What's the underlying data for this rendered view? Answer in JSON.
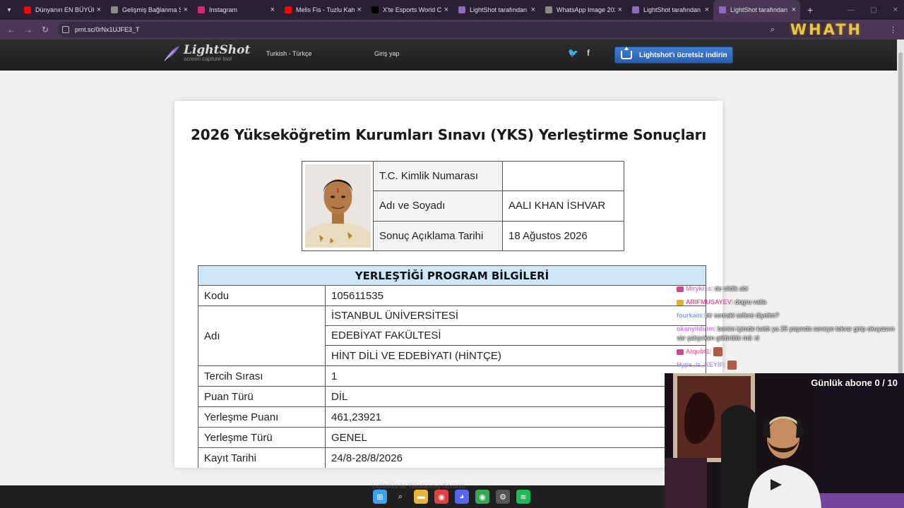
{
  "browser": {
    "tabs": [
      {
        "title": "Dünyanın EN BÜYÜK",
        "icon": "youtube-icon",
        "color": "#ff0000"
      },
      {
        "title": "Gelişmiş Bağlanma Sı",
        "icon": "globe-icon",
        "color": "#8a8a8a"
      },
      {
        "title": "Instagram",
        "icon": "instagram-icon",
        "color": "#d62976"
      },
      {
        "title": "Melis Fis - Tuzlu Kahv",
        "icon": "youtube-icon",
        "color": "#ff0000"
      },
      {
        "title": "X'te Esports World C",
        "icon": "x-icon",
        "color": "#000000"
      },
      {
        "title": "LightShot tarafından",
        "icon": "lightshot-icon",
        "color": "#8e6bbf"
      },
      {
        "title": "WhatsApp Image 202",
        "icon": "globe-icon",
        "color": "#8a8a8a"
      },
      {
        "title": "LightShot tarafından",
        "icon": "lightshot-icon",
        "color": "#8e6bbf"
      },
      {
        "title": "LightShot tarafından",
        "icon": "lightshot-icon",
        "color": "#8e6bbf",
        "active": true
      }
    ],
    "url": "prnt.sc/0rNx1UJFE3_T"
  },
  "stream_logo": "WHATH",
  "lightshot": {
    "brand": "LightShot",
    "tagline": "screen capture tool",
    "language": "Turkish - Türkçe",
    "login": "Giriş yap",
    "download": "Lightshot'ı ücretsiz indirin"
  },
  "document": {
    "title": "2026 Yükseköğretim Kurumları Sınavı (YKS) Yerleştirme Sonuçları",
    "identity": [
      {
        "label": "T.C. Kimlik Numarası",
        "value": ""
      },
      {
        "label": "Adı ve Soyadı",
        "value": "AALI KHAN İSHVAR"
      },
      {
        "label": "Sonuç Açıklama Tarihi",
        "value": "18 Ağustos 2026"
      }
    ],
    "program_header": "YERLEŞTİĞİ PROGRAM BİLGİLERİ",
    "program": {
      "code_label": "Kodu",
      "code": "105611535",
      "name_label": "Adı",
      "name_lines": [
        "İSTANBUL ÜNİVERSİTESİ",
        "EDEBİYAT FAKÜLTESİ",
        "HİNT DİLİ VE EDEBİYATI (HİNTÇE)"
      ],
      "rows": [
        {
          "label": "Tercih Sırası",
          "value": "1"
        },
        {
          "label": "Puan Türü",
          "value": "DİL"
        },
        {
          "label": "Yerleşme Puanı",
          "value": "461,23921"
        },
        {
          "label": "Yerleşme Türü",
          "value": "GENEL"
        },
        {
          "label": "Kayıt Tarihi",
          "value": "24/8-28/8/2026"
        }
      ]
    }
  },
  "chat": [
    {
      "user": "Mirykiss",
      "text": ": de sildik abi",
      "color": "#e07ad0",
      "badge": "#c9488f"
    },
    {
      "user": "ARIFMUSAYEV",
      "text": ": dogru valla",
      "color": "#e05a9a",
      "badge": "#e0b030"
    },
    {
      "user": "fourkain",
      "text": ": bir sonraki sefere diyelim?",
      "color": "#6fa8ff",
      "badge": ""
    },
    {
      "user": "okanyildirim",
      "text": ": benim içimde kaldı ya 25 yaşında seneye tekrar girip okuyasım var çalışırken götürülür mü :d",
      "color": "#d27bff",
      "badge": ""
    },
    {
      "user": "Alqubt1",
      "text": ":",
      "color": "#ff6fa0",
      "badge": "#c9488f",
      "emote": true
    },
    {
      "user": "Hype_is_KEYIF",
      "text": ":",
      "color": "#b98cff",
      "badge": "",
      "emote": true
    }
  ],
  "webcam": {
    "counter": "Günlük abone 0 / 10"
  },
  "taskbar": {
    "ghost_text": "Lightshot ile Yakalanmış Görüntü",
    "icons": [
      {
        "name": "windows-start-icon",
        "color": "#3ea0f0",
        "glyph": "⊞"
      },
      {
        "name": "search-icon",
        "color": "#202020",
        "glyph": "⌕"
      },
      {
        "name": "file-explorer-icon",
        "color": "#e8b33a",
        "glyph": "▬"
      },
      {
        "name": "chrome-icon",
        "color": "#e04040",
        "glyph": "◉"
      },
      {
        "name": "discord-icon",
        "color": "#5865f2",
        "glyph": "◕"
      },
      {
        "name": "chrome-profile-icon",
        "color": "#34a853",
        "glyph": "◉"
      },
      {
        "name": "settings-icon",
        "color": "#555555",
        "glyph": "⚙"
      },
      {
        "name": "spotify-icon",
        "color": "#1db954",
        "glyph": "≋"
      }
    ]
  }
}
